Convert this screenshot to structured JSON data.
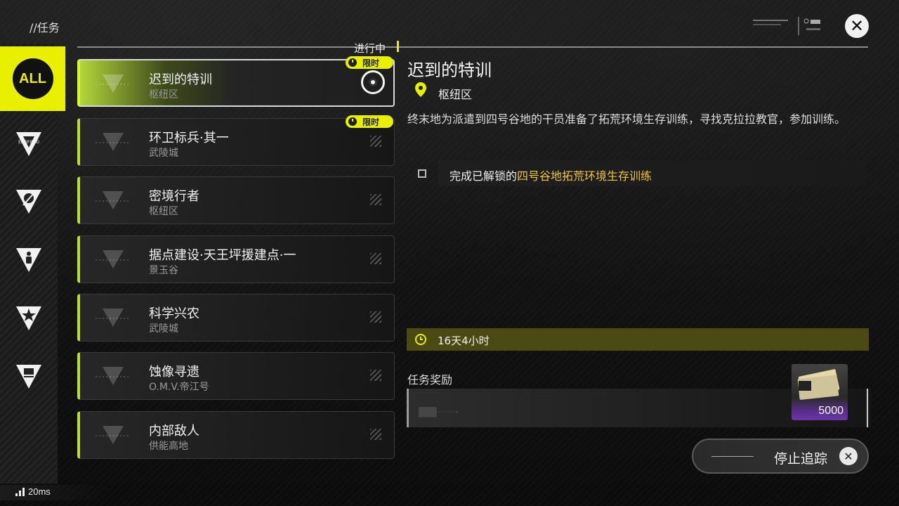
{
  "header": {
    "title": "//任务"
  },
  "colors": {
    "accent": "#e8f000",
    "highlight": "#f0c53a",
    "card_border": "#b9e02a"
  },
  "sidebar": {
    "items": [
      {
        "label": "ALL",
        "icon": "all-filter-icon",
        "selected": true
      },
      {
        "label": "ENDFIELD",
        "icon": "endfield-category-icon"
      },
      {
        "label": "",
        "icon": "feather-category-icon"
      },
      {
        "label": "",
        "icon": "person-category-icon"
      },
      {
        "label": "",
        "icon": "star-category-icon"
      },
      {
        "label": "",
        "icon": "flag-category-icon"
      }
    ]
  },
  "list": {
    "ongoing_label": "进行中",
    "badge_label": "限时",
    "missions": [
      {
        "title": "迟到的特训",
        "region": "枢纽区",
        "active": true,
        "limited": true
      },
      {
        "title": "环卫标兵·其一",
        "region": "武陵城",
        "limited": true
      },
      {
        "title": "密境行者",
        "region": "枢纽区"
      },
      {
        "title": "据点建设·天王坪援建点·一",
        "region": "景玉谷"
      },
      {
        "title": "科学兴农",
        "region": "武陵城"
      },
      {
        "title": "蚀像寻遗",
        "region": "O.M.V.帝江号"
      },
      {
        "title": "内部敌人",
        "region": "供能高地"
      }
    ]
  },
  "detail": {
    "title": "迟到的特训",
    "location": "枢纽区",
    "description": "终末地为派遣到四号谷地的干员准备了拓荒环境生存训练，寻找克拉拉教官，参加训练。",
    "objective_prefix": "完成已解锁的",
    "objective_highlight": "四号谷地拓荒环境生存训练",
    "time_left": "16天4小时",
    "reward_label": "任务奖励",
    "reward_quantity": "5000",
    "stop_tracking": "停止追踪"
  },
  "status": {
    "ping": "20ms"
  }
}
